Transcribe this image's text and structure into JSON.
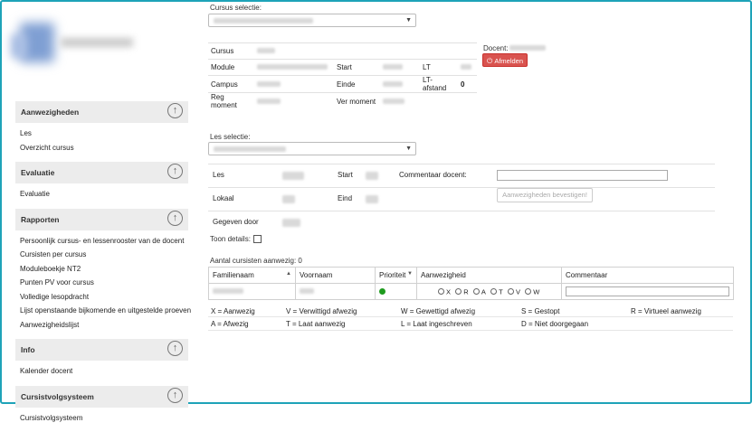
{
  "sidebar": {
    "sections": [
      {
        "title": "Aanwezigheden",
        "items": [
          "Les",
          "Overzicht cursus"
        ]
      },
      {
        "title": "Evaluatie",
        "items": [
          "Evaluatie"
        ]
      },
      {
        "title": "Rapporten",
        "items": [
          "Persoonlijk cursus- en lessenrooster van de docent",
          "Cursisten per cursus",
          "Moduleboekje NT2",
          "Punten PV voor cursus",
          "Volledige lesopdracht",
          "Lijst openstaande bijkomende en uitgestelde proeven",
          "Aanwezigheidslijst"
        ]
      },
      {
        "title": "Info",
        "items": [
          "Kalender docent"
        ]
      },
      {
        "title": "Cursistvolgsysteem",
        "items": [
          "Cursistvolgsysteem"
        ]
      }
    ]
  },
  "course": {
    "selection_label": "Cursus selectie:",
    "labels": {
      "cursus": "Cursus",
      "module": "Module",
      "start": "Start",
      "lt": "LT",
      "campus": "Campus",
      "einde": "Einde",
      "lt_afstand": "LT-afstand",
      "reg_moment": "Reg moment",
      "ver_moment": "Ver moment"
    },
    "lt_afstand_value": "0",
    "docent_label": "Docent:",
    "afmelden_label": "Afmelden"
  },
  "lesson": {
    "selection_label": "Les selectie:",
    "labels": {
      "les": "Les",
      "start": "Start",
      "commentaar": "Commentaar docent:",
      "lokaal": "Lokaal",
      "einde": "Eind",
      "gegeven_door": "Gegeven door"
    },
    "confirm_button": "Aanwezigheden bevestigen!",
    "toon_details": "Toon details:"
  },
  "attendance": {
    "count_label": "Aantal cursisten aanwezig: 0",
    "columns": [
      "Familienaam",
      "Voornaam",
      "Prioriteit",
      "Aanwezigheid",
      "Commentaar"
    ],
    "status_color": "#1e9b1e",
    "options": [
      "X",
      "R",
      "A",
      "T",
      "V",
      "W"
    ]
  },
  "legend": [
    [
      "X = Aanwezig",
      "V = Verwittigd afwezig",
      "W = Gewettigd afwezig",
      "S = Gestopt",
      "R = Virtueel aanwezig"
    ],
    [
      "A = Afwezig",
      "T = Laat aanwezig",
      "L = Laat ingeschreven",
      "D = Niet doorgegaan"
    ]
  ]
}
